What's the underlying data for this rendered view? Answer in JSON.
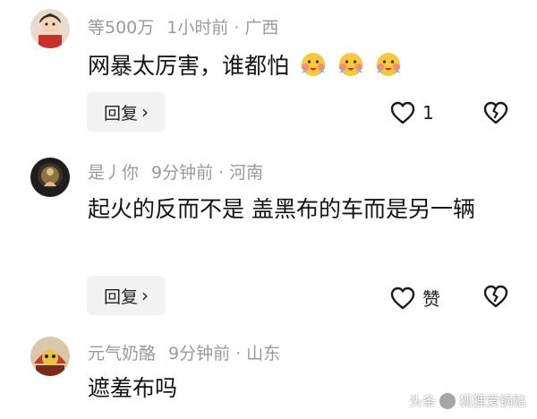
{
  "comments": [
    {
      "username": "等500万",
      "time": "1小时前",
      "location": "广西",
      "text": "网暴太厉害，谁都怕",
      "emoji": "hot-face-emoji",
      "reply_label": "回复",
      "like_count": "1"
    },
    {
      "username": "是丿你",
      "time": "9分钟前",
      "location": "河南",
      "text": "起火的反而不是 盖黑布的车而是另一辆",
      "reply_label": "回复",
      "like_count": "赞"
    },
    {
      "username": "元气奶酪",
      "time": "9分钟前",
      "location": "山东",
      "text": "遮羞布吗"
    }
  ],
  "separator": "·",
  "watermark": {
    "prefix": "头条",
    "handle": "狐狸爱锅贴"
  },
  "colors": {
    "meta": "#9a9a9a",
    "text": "#141414",
    "reply_bg": "#f2f2f2"
  }
}
